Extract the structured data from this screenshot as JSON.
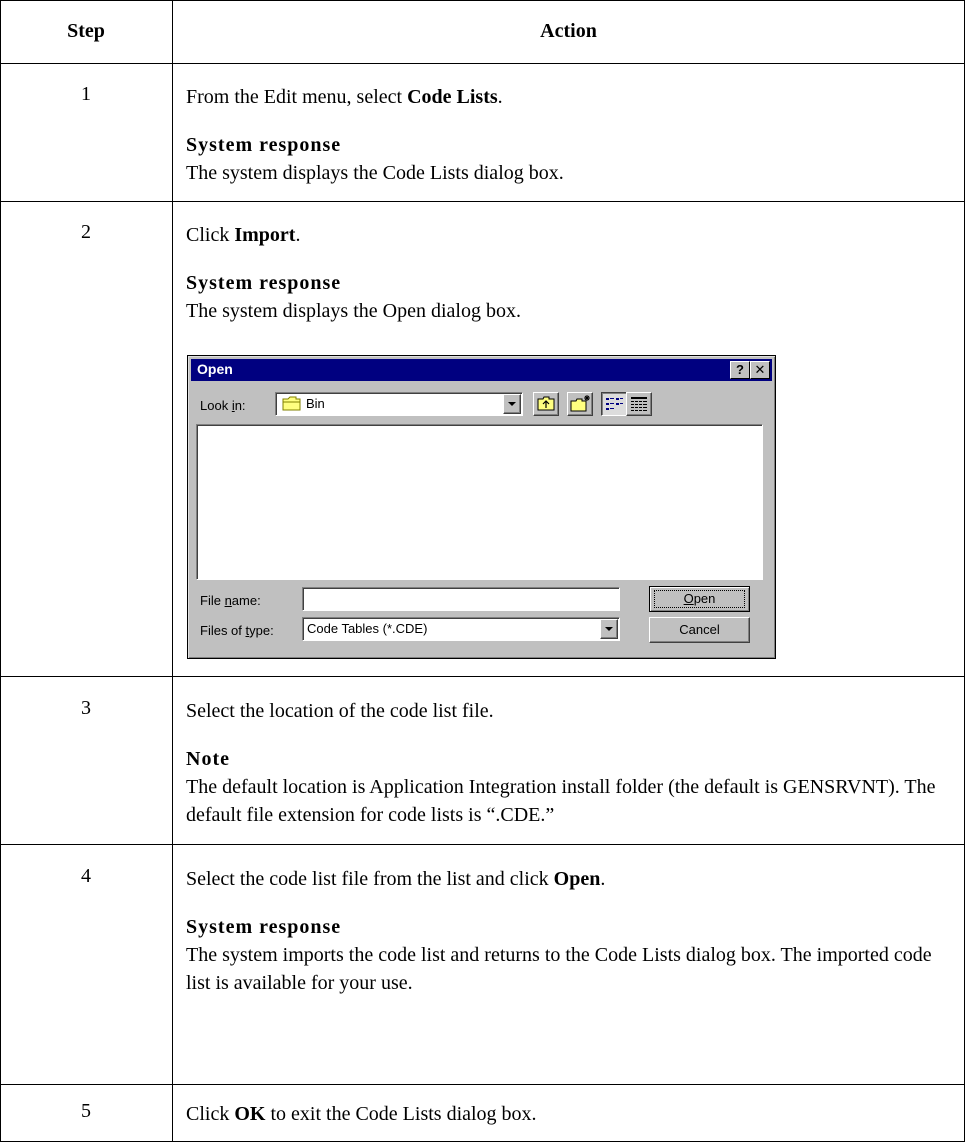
{
  "table": {
    "header": {
      "step": "Step",
      "action": "Action"
    }
  },
  "rows": [
    {
      "step": "1",
      "line1_pre": "From the Edit menu, select ",
      "line1_bold": "Code Lists",
      "line1_post": ".",
      "sub_heading": "System response",
      "sub_text": "The system displays the Code Lists dialog box."
    },
    {
      "step": "2",
      "line1_pre": "Click ",
      "line1_bold": "Import",
      "line1_post": ".",
      "sub_heading": "System response",
      "sub_text": "The system displays the Open dialog box."
    },
    {
      "step": "3",
      "line1": "Select the location of the code list file.",
      "sub_heading": "Note",
      "sub_text": "The default location is Application Integration install folder (the default is GENSRVNT). The default file extension for code lists is “.CDE.”"
    },
    {
      "step": "4",
      "line1_pre": "Select the code list file from the list and click ",
      "line1_bold": "Open",
      "line1_post": ".",
      "sub_heading": "System response",
      "sub_text": "The system imports the code list and returns to the Code Lists dialog box. The imported code list is available for your use."
    },
    {
      "step": "5",
      "line1_pre": "Click ",
      "line1_bold": "OK",
      "line1_post": " to exit the Code Lists dialog box."
    }
  ],
  "dialog": {
    "title": "Open",
    "help_btn": "?",
    "close_btn": "✕",
    "look_in_label_pre": "Look ",
    "look_in_label_key": "i",
    "look_in_label_post": "n:",
    "look_in_value": "Bin",
    "file_name_label_pre": "File ",
    "file_name_label_key": "n",
    "file_name_label_post": "ame:",
    "file_name_value": "",
    "files_of_type_label_pre": "Files of ",
    "files_of_type_label_key": "t",
    "files_of_type_label_post": "ype:",
    "files_of_type_value": "Code Tables (*.CDE)",
    "open_btn_key": "O",
    "open_btn_rest": "pen",
    "cancel_btn": "Cancel",
    "icons": [
      "folder-icon",
      "up-folder-icon",
      "new-folder-icon",
      "list-view-icon",
      "details-view-icon",
      "dropdown-arrow-icon"
    ]
  }
}
